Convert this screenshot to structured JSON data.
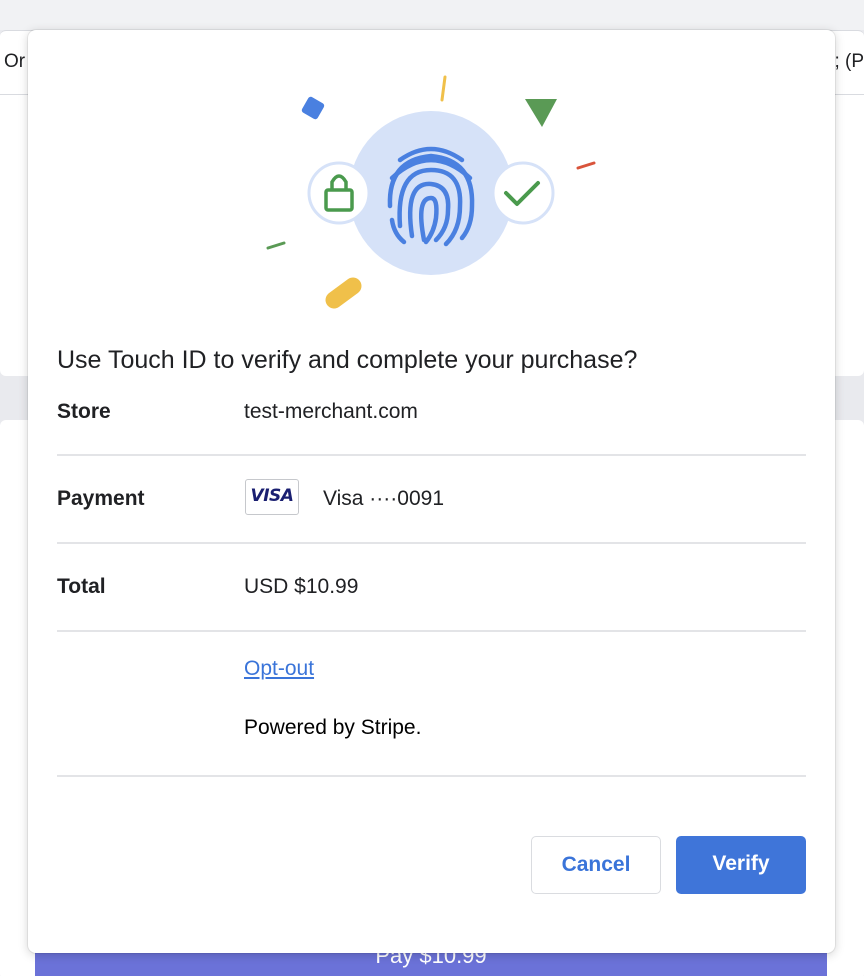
{
  "background": {
    "tab_left": "Or",
    "tab_right": "; (P",
    "pay_button": "Pay $10.99"
  },
  "dialog": {
    "title": "Use Touch ID to verify and complete your purchase?",
    "store": {
      "label": "Store",
      "value": "test-merchant.com"
    },
    "payment": {
      "label": "Payment",
      "card_brand": "VISA",
      "value": "Visa ····0091"
    },
    "total": {
      "label": "Total",
      "value": "USD $10.99"
    },
    "opt_out": "Opt-out",
    "powered_by": "Powered by Stripe.",
    "cancel_label": "Cancel",
    "verify_label": "Verify"
  },
  "icons": [
    "fingerprint-icon",
    "lock-icon",
    "checkmark-icon"
  ],
  "colors": {
    "accent": "#3f75d9",
    "link": "#3a74d9",
    "fingerprint_circle": "#d6e2f8",
    "fingerprint": "#4a80e0",
    "lock": "#4a9a4d",
    "check": "#4a9a4d",
    "confetti_blue": "#4a80e0",
    "confetti_green": "#5a9a55",
    "confetti_yellow": "#f0c04a",
    "confetti_red": "#d9543b"
  }
}
